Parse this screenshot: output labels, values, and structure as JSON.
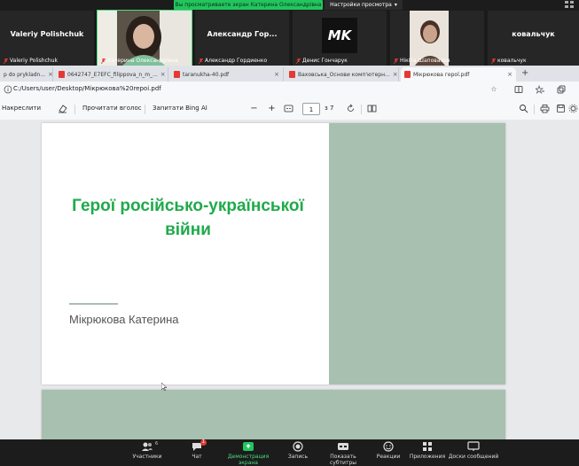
{
  "banner": {
    "share_text": "Вы просматриваете экран Катерина Олександрівна",
    "view_options": "Настройки просмотра"
  },
  "participants": [
    {
      "big": "Valeriy Polishchuk",
      "small": "Valeriy Polishchuk"
    },
    {
      "big": "",
      "small": "Катерина Олександрівна"
    },
    {
      "big": "Александр Гор...",
      "small": "Александр Гордиенко"
    },
    {
      "big": "MK",
      "small": "Денис Гончарук"
    },
    {
      "big": "",
      "small": "Нікіта Шаповалов"
    },
    {
      "big": "ковальчук",
      "small": "ковальчук"
    }
  ],
  "browser": {
    "tabs": [
      {
        "label": "p do prykladn..."
      },
      {
        "label": "0642747_E7EFC_filippova_n_m_..."
      },
      {
        "label": "taranukha-40.pdf"
      },
      {
        "label": "Ваховська_Основи комп'ютерн..."
      },
      {
        "label": "Мікрюкова герої.pdf"
      }
    ],
    "new_tab": "+",
    "url": "C:/Users/user/Desktop/Мікрюкова%20repoi.pdf"
  },
  "pdf_toolbar": {
    "draw": "Накреслити",
    "read_aloud": "Прочитати вголос",
    "ask_bing": "Запитати Bing AI",
    "zoom_out": "−",
    "zoom_in": "+",
    "page_current": "1",
    "page_total": "з 7"
  },
  "slide": {
    "title_line1": "Герої російсько-української",
    "title_line2": "війни",
    "author": "Мікрюкова Катерина"
  },
  "zoom_toolbar": {
    "participants": "Участники",
    "participants_count": "6",
    "chat": "Чат",
    "chat_badge": "1",
    "share": "Демонстрация экрана",
    "record": "Запись",
    "captions": "Показать субтитры",
    "reactions": "Реакции",
    "apps": "Приложения",
    "whiteboards": "Доски сообщений"
  }
}
